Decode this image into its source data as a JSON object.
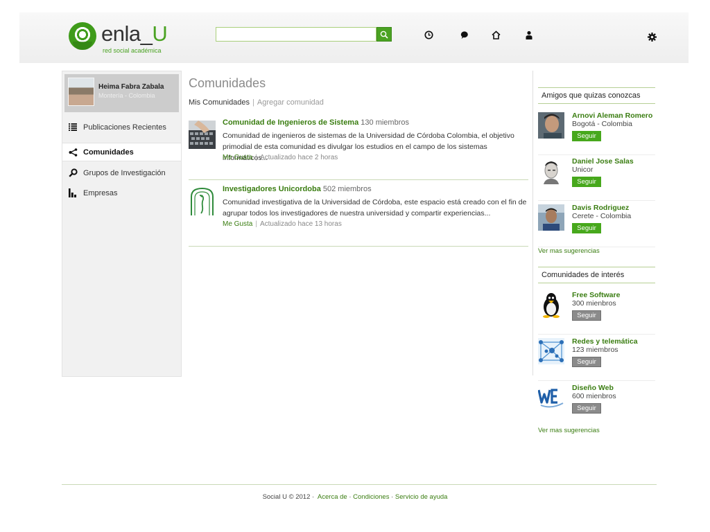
{
  "header": {
    "logo_word_prefix": "enla_",
    "logo_word_suffix": "U",
    "logo_tagline": "red social académica",
    "search": {
      "value": "",
      "placeholder": ""
    },
    "nav_icons": [
      "clock-icon",
      "chat-bubble-icon",
      "home-icon",
      "user-icon",
      "gear-icon"
    ]
  },
  "sidebar": {
    "profile": {
      "name": "Heima Fabra Zabala",
      "location": "Montería - Colombia"
    },
    "items": [
      {
        "label": "Publicaciones Recientes",
        "icon": "list-icon",
        "active": false
      },
      {
        "label": "Comunidades",
        "icon": "share-icon",
        "active": true
      },
      {
        "label": "Grupos de Investigación",
        "icon": "magnifier-icon",
        "active": false
      },
      {
        "label": "Empresas",
        "icon": "bar-chart-icon",
        "active": false
      }
    ]
  },
  "main": {
    "title": "Comunidades",
    "tabs": {
      "mine": "Mis Comunidades",
      "separator": "|",
      "add": "Agregar comunidad"
    },
    "communities": [
      {
        "name": "Comunidad de Ingenieros de Sistema",
        "members": "130 miembros",
        "description": "Comunidad de ingenieros de sistemas de la Universidad de Córdoba Colombia, el objetivo primodial de esta comunidad es divulgar los estudios en el campo de los sistemas informáticos...",
        "like": "Me Gusta",
        "meta_separator": "|",
        "updated": "Actualizado hace 2 horas"
      },
      {
        "name": "Investigadores Unicordoba",
        "members": "502 miembros",
        "description": "Comunidad investigativa de la Universidad de Córdoba, este espacio está creado con el fin de agrupar todos los investigadores de nuestra universidad y compartir experiencias...",
        "like": "Me Gusta",
        "meta_separator": "|",
        "updated": "Actualizado hace 13 horas"
      }
    ]
  },
  "right": {
    "friends": {
      "title": "Amigos que quizas conozcas",
      "items": [
        {
          "name": "Arnovi Aleman Romero",
          "sub": "Bogotá - Colombia",
          "button": "Seguir"
        },
        {
          "name": "Daniel Jose Salas",
          "sub": "Unicor",
          "button": "Seguir"
        },
        {
          "name": "Davis Rodriguez",
          "sub": "Cerete  - Colombia",
          "button": "Seguir"
        }
      ],
      "more": "Ver mas sugerencias"
    },
    "communities": {
      "title": "Comunidades de interés",
      "items": [
        {
          "name": "Free Software",
          "sub": "300 mienbros",
          "button": "Seguir"
        },
        {
          "name": "Redes y telemática",
          "sub": "123 miembros",
          "button": "Seguir"
        },
        {
          "name": "Diseño Web",
          "sub": "600 mienbros",
          "button": "Seguir"
        }
      ],
      "more": "Ver mas sugerencias"
    }
  },
  "footer": {
    "copyright": "Social U © 2012 ·",
    "links": [
      "Acerca de",
      "Condiciones",
      "Servicio de ayuda"
    ],
    "separator": "·"
  },
  "colors": {
    "accent": "#47a81c",
    "link": "#3a7d11",
    "rule": "#c9d9b6",
    "sidebar_bg": "#f1f1f1"
  }
}
